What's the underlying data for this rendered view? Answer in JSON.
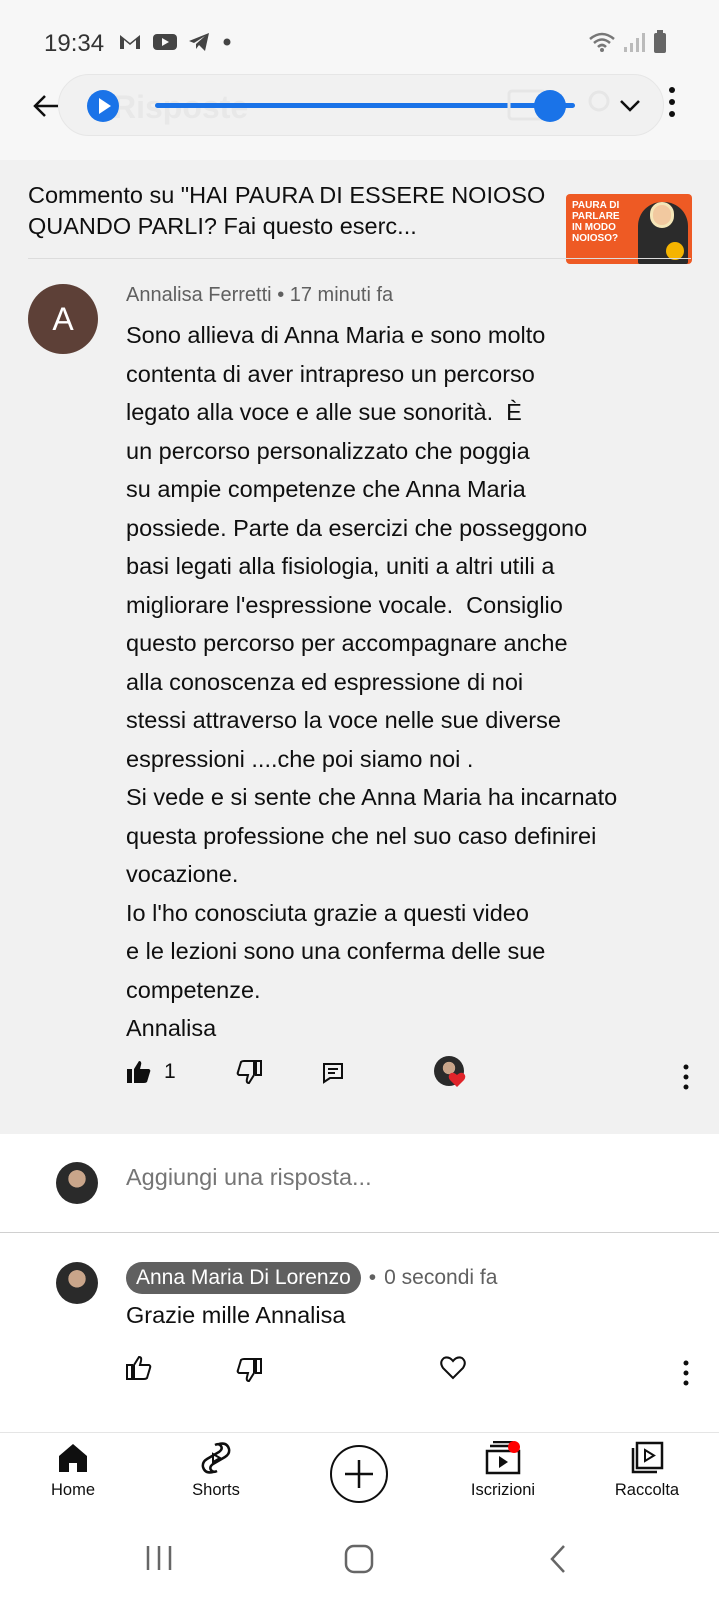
{
  "status_bar": {
    "time": "19:34",
    "icons": [
      "gmail-icon",
      "youtube-icon",
      "telegram-icon",
      "dot-icon"
    ],
    "right_icons": [
      "wifi-icon",
      "signal-icon",
      "battery-icon"
    ]
  },
  "top_bar": {
    "title": "Risposte",
    "progress": 0.94
  },
  "context": {
    "text": "Commento su \"HAI PAURA DI ESSERE NOIOSO QUANDO PARLI? Fai questo eserc...",
    "thumb_text": "PAURA DI PARLARE IN MODO NOIOSO?"
  },
  "comment": {
    "avatar_letter": "A",
    "author": "Annalisa Ferretti",
    "time": "17 minuti fa",
    "body": "Sono allieva di Anna Maria e sono molto\ncontenta di aver intrapreso un percorso\nlegato alla voce e alle sue sonorità.  È\nun percorso personalizzato che poggia\nsu ampie competenze che Anna Maria\npossiede. Parte da esercizi che posseggono\nbasi legati alla fisiologia, uniti a altri utili a\nmigliorare l'espressione vocale.  Consiglio\nquesto percorso per accompagnare anche\nalla conoscenza ed espressione di noi\nstessi attraverso la voce nelle sue diverse\nespressioni ....che poi siamo noi .\nSi vede e si sente che Anna Maria ha incarnato\nquesta professione che nel suo caso definirei\nvocazione.\nIo l'ho conosciuta grazie a questi video\ne le lezioni sono una conferma delle sue\ncompetenze.\nAnnalisa",
    "like_count": "1"
  },
  "reply_input": {
    "placeholder": "Aggiungi una risposta..."
  },
  "reply": {
    "author": "Anna Maria Di Lorenzo",
    "time": "0 secondi fa",
    "text": "Grazie mille Annalisa"
  },
  "bottom_nav": {
    "items": [
      {
        "label": "Home",
        "icon": "home-icon"
      },
      {
        "label": "Shorts",
        "icon": "shorts-icon"
      },
      {
        "label": "",
        "icon": "create-icon"
      },
      {
        "label": "Iscrizioni",
        "icon": "subscriptions-icon"
      },
      {
        "label": "Raccolta",
        "icon": "library-icon"
      }
    ]
  },
  "colors": {
    "accent": "#1a73e8",
    "avatar_bg": "#5d4037",
    "thumb_bg": "#ee5a24",
    "notification": "#ff0000"
  }
}
